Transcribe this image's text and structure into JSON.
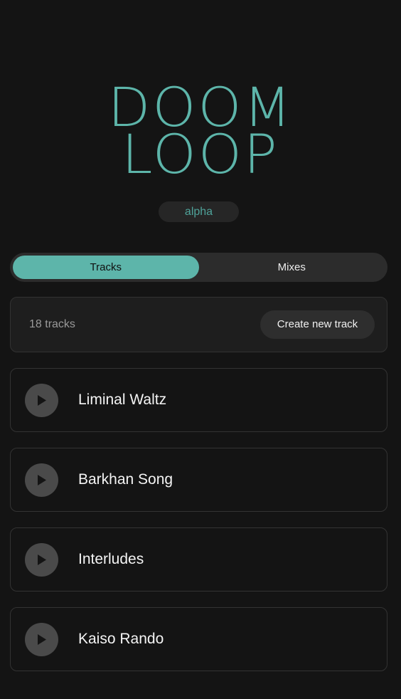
{
  "app": {
    "logo_line1": "DOOM",
    "logo_line2": "LOOP",
    "badge": "alpha"
  },
  "tabs": [
    {
      "label": "Tracks",
      "active": true
    },
    {
      "label": "Mixes",
      "active": false
    }
  ],
  "tracks_bar": {
    "count_text": "18 tracks",
    "create_label": "Create new track"
  },
  "tracks": [
    {
      "title": "Liminal Waltz",
      "icon": "play-icon"
    },
    {
      "title": "Barkhan Song",
      "icon": "play-icon"
    },
    {
      "title": "Interludes",
      "icon": "play-icon"
    },
    {
      "title": "Kaiso Rando",
      "icon": "play-icon"
    }
  ],
  "colors": {
    "background": "#141414",
    "accent": "#5db5aa",
    "surface": "#1e1e1e",
    "button": "#2e2e2e",
    "play_button": "#4a4a4a"
  }
}
